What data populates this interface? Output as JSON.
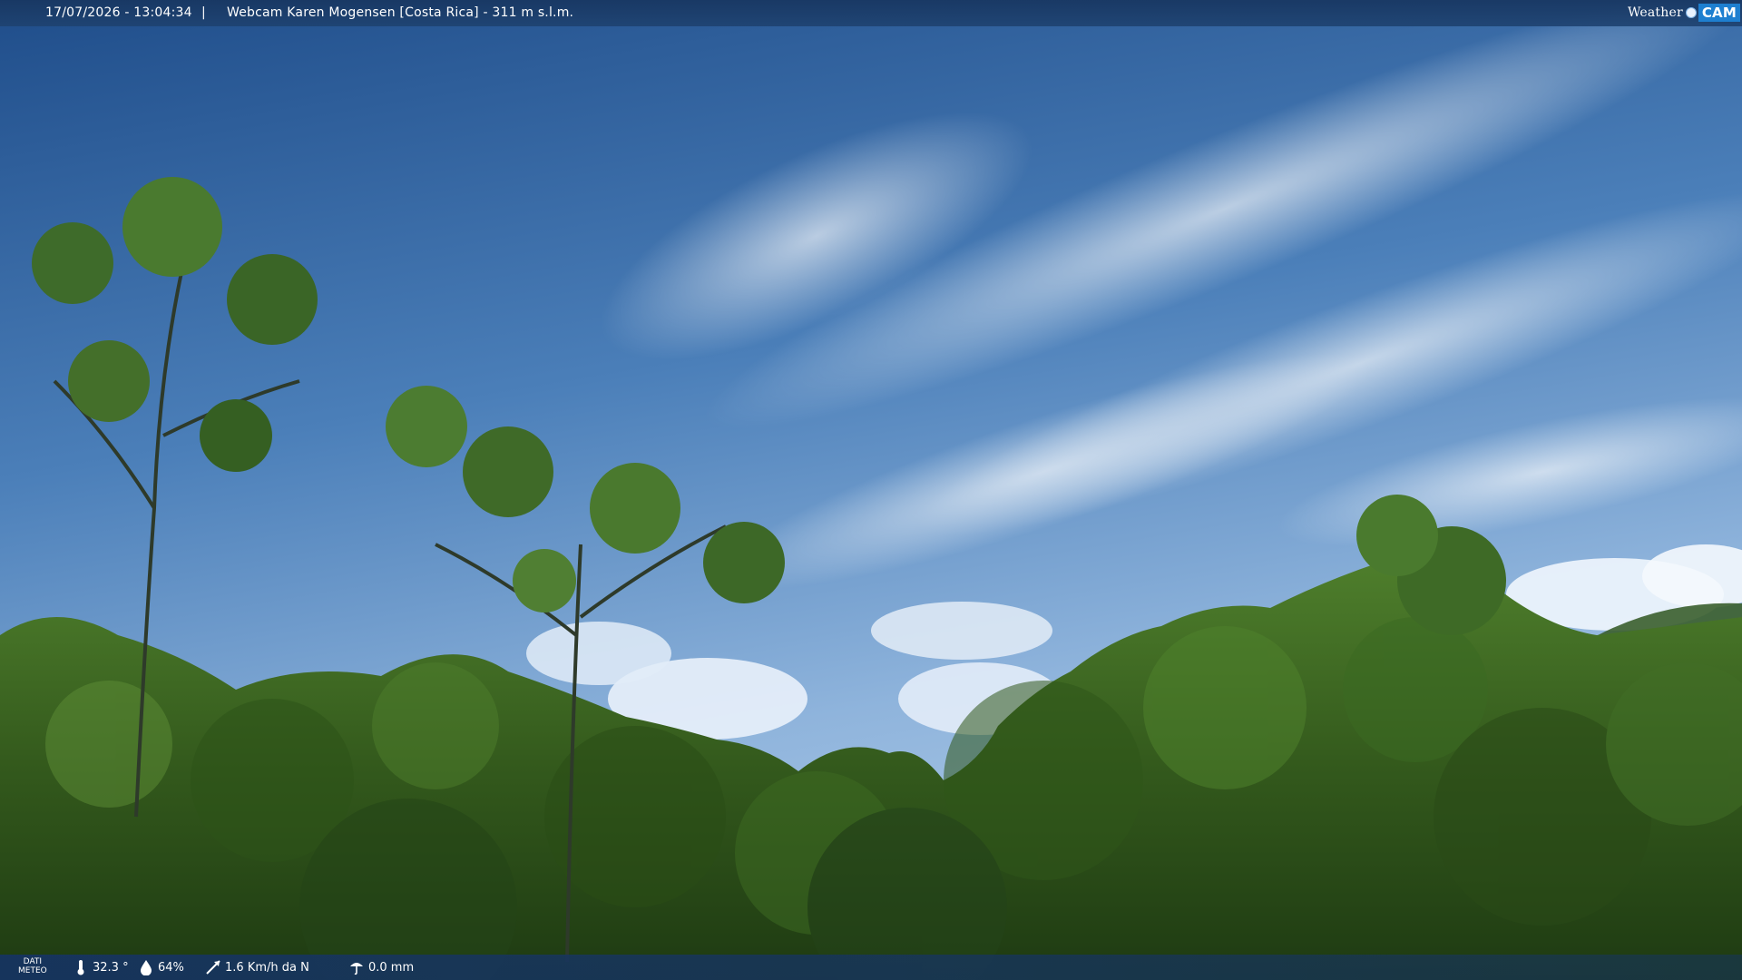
{
  "overlay_top": {
    "datetime": "17/07/2026 - 13:04:34",
    "separator": "|",
    "title": "Webcam Karen Mogensen [Costa Rica] - 311 m s.l.m.",
    "logo": {
      "word": "Weather",
      "cam": "CAM"
    }
  },
  "overlay_bottom": {
    "dati_line1": "DATI",
    "dati_line2": "METEO",
    "temperature": "32.3 °",
    "humidity": "64%",
    "wind": "1.6 Km/h da N",
    "rain": "0.0 mm",
    "icons": [
      "thermometer-icon",
      "humidity-icon",
      "wind-icon",
      "rain-gauge-icon"
    ]
  },
  "colors": {
    "sky_top": "#1f4f8c",
    "sky_mid": "#4a7fb8",
    "sky_low": "#9dbfe0",
    "foliage_dark": "#1f3d14",
    "foliage_mid": "#3f6e24",
    "foliage_light": "#6f9b3e"
  }
}
